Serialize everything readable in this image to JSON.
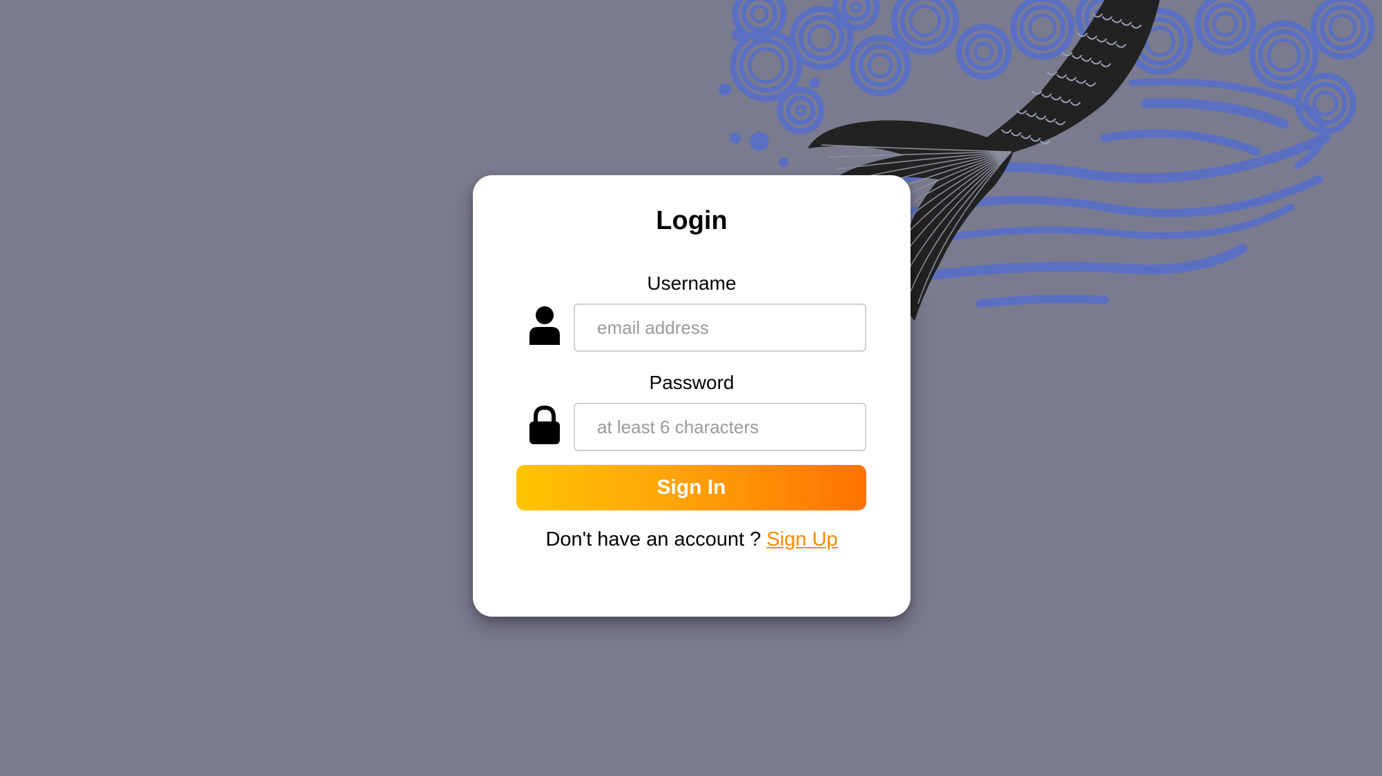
{
  "colors": {
    "background": "#7a7b8f",
    "card": "#ffffff",
    "wave": "#5a6fc1",
    "koi": "#222222",
    "button_gradient_start": "#ffc400",
    "button_gradient_end": "#ff7300",
    "link": "#ff8a00"
  },
  "background": {
    "art": "koi-fish-with-waves-illustration"
  },
  "login": {
    "title": "Login",
    "username": {
      "label": "Username",
      "placeholder": "email address",
      "value": "",
      "icon": "user-icon"
    },
    "password": {
      "label": "Password",
      "placeholder": "at least 6 characters",
      "value": "",
      "icon": "lock-icon"
    },
    "submit_label": "Sign In",
    "signup_prompt": "Don't have an account ? ",
    "signup_link": "Sign Up"
  }
}
